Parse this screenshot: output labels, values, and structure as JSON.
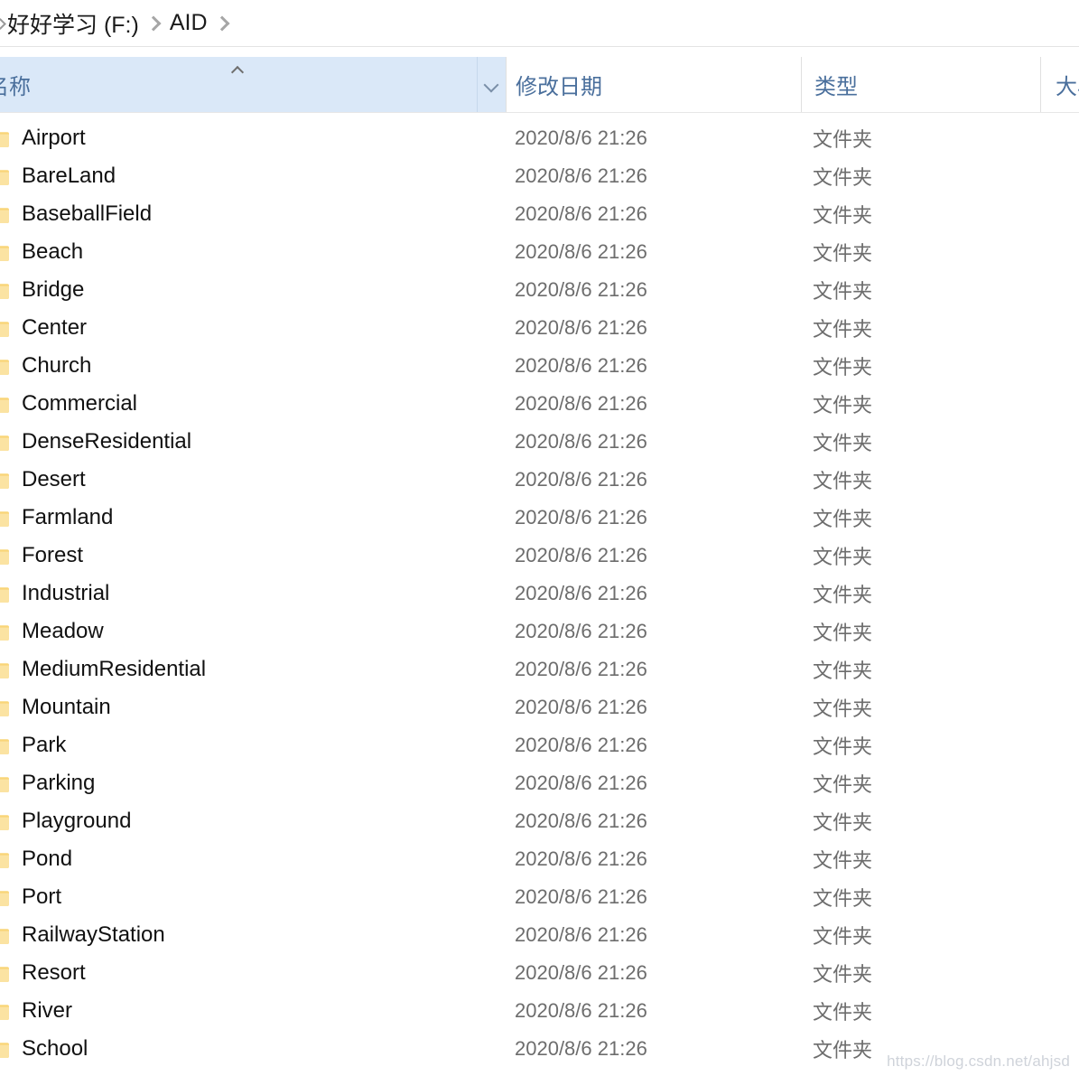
{
  "breadcrumb": {
    "back_icon": "chevron-left-icon",
    "items": [
      {
        "label": "好好学习 (F:)"
      },
      {
        "label": "AID"
      }
    ],
    "separator_icon": "chevron-right-icon"
  },
  "columns": {
    "name": {
      "label": "名称",
      "sort_indicator": "sort-ascending-icon",
      "dropdown_icon": "chevron-down-icon"
    },
    "date_modified": {
      "label": "修改日期"
    },
    "type": {
      "label": "类型"
    },
    "size": {
      "label": "大小"
    }
  },
  "files": [
    {
      "icon": "folder-icon",
      "name": "Airport",
      "date": "2020/8/6 21:26",
      "type": "文件夹",
      "size": ""
    },
    {
      "icon": "folder-icon",
      "name": "BareLand",
      "date": "2020/8/6 21:26",
      "type": "文件夹",
      "size": ""
    },
    {
      "icon": "folder-icon",
      "name": "BaseballField",
      "date": "2020/8/6 21:26",
      "type": "文件夹",
      "size": ""
    },
    {
      "icon": "folder-icon",
      "name": "Beach",
      "date": "2020/8/6 21:26",
      "type": "文件夹",
      "size": ""
    },
    {
      "icon": "folder-icon",
      "name": "Bridge",
      "date": "2020/8/6 21:26",
      "type": "文件夹",
      "size": ""
    },
    {
      "icon": "folder-icon",
      "name": "Center",
      "date": "2020/8/6 21:26",
      "type": "文件夹",
      "size": ""
    },
    {
      "icon": "folder-icon",
      "name": "Church",
      "date": "2020/8/6 21:26",
      "type": "文件夹",
      "size": ""
    },
    {
      "icon": "folder-icon",
      "name": "Commercial",
      "date": "2020/8/6 21:26",
      "type": "文件夹",
      "size": ""
    },
    {
      "icon": "folder-icon",
      "name": "DenseResidential",
      "date": "2020/8/6 21:26",
      "type": "文件夹",
      "size": ""
    },
    {
      "icon": "folder-icon",
      "name": "Desert",
      "date": "2020/8/6 21:26",
      "type": "文件夹",
      "size": ""
    },
    {
      "icon": "folder-icon",
      "name": "Farmland",
      "date": "2020/8/6 21:26",
      "type": "文件夹",
      "size": ""
    },
    {
      "icon": "folder-icon",
      "name": "Forest",
      "date": "2020/8/6 21:26",
      "type": "文件夹",
      "size": ""
    },
    {
      "icon": "folder-icon",
      "name": "Industrial",
      "date": "2020/8/6 21:26",
      "type": "文件夹",
      "size": ""
    },
    {
      "icon": "folder-icon",
      "name": "Meadow",
      "date": "2020/8/6 21:26",
      "type": "文件夹",
      "size": ""
    },
    {
      "icon": "folder-icon",
      "name": "MediumResidential",
      "date": "2020/8/6 21:26",
      "type": "文件夹",
      "size": ""
    },
    {
      "icon": "folder-icon",
      "name": "Mountain",
      "date": "2020/8/6 21:26",
      "type": "文件夹",
      "size": ""
    },
    {
      "icon": "folder-icon",
      "name": "Park",
      "date": "2020/8/6 21:26",
      "type": "文件夹",
      "size": ""
    },
    {
      "icon": "folder-icon",
      "name": "Parking",
      "date": "2020/8/6 21:26",
      "type": "文件夹",
      "size": ""
    },
    {
      "icon": "folder-icon",
      "name": "Playground",
      "date": "2020/8/6 21:26",
      "type": "文件夹",
      "size": ""
    },
    {
      "icon": "folder-icon",
      "name": "Pond",
      "date": "2020/8/6 21:26",
      "type": "文件夹",
      "size": ""
    },
    {
      "icon": "folder-icon",
      "name": "Port",
      "date": "2020/8/6 21:26",
      "type": "文件夹",
      "size": ""
    },
    {
      "icon": "folder-icon",
      "name": "RailwayStation",
      "date": "2020/8/6 21:26",
      "type": "文件夹",
      "size": ""
    },
    {
      "icon": "folder-icon",
      "name": "Resort",
      "date": "2020/8/6 21:26",
      "type": "文件夹",
      "size": ""
    },
    {
      "icon": "folder-icon",
      "name": "River",
      "date": "2020/8/6 21:26",
      "type": "文件夹",
      "size": ""
    },
    {
      "icon": "folder-icon",
      "name": "School",
      "date": "2020/8/6 21:26",
      "type": "文件夹",
      "size": ""
    }
  ],
  "watermark": {
    "text": "https://blog.csdn.net/ahjsd"
  },
  "colors": {
    "header_background": "#dae8f8",
    "header_text": "#4a6f9c",
    "row_text": "#111111",
    "secondary_text": "#6d6d6d",
    "folder_icon": "#f9d578",
    "watermark_text": "#cfd3da"
  }
}
